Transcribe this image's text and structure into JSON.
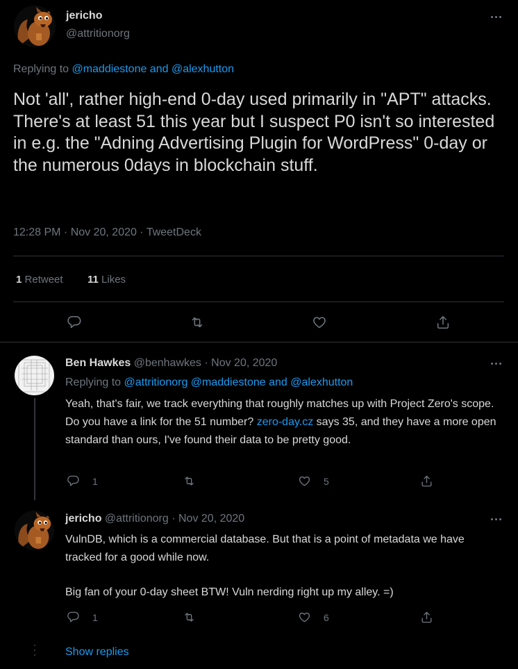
{
  "main_tweet": {
    "author_name": "jericho",
    "author_handle": "@attritionorg",
    "replying_prefix": "Replying to ",
    "replying_users": "@maddiestone and @alexhutton",
    "text": "Not 'all', rather high-end 0-day used primarily in \"APT\" attacks. There's at least 51 this year but I suspect P0 isn't so interested in e.g. the \"Adning Advertising Plugin for WordPress\" 0-day or the numerous 0days in blockchain stuff.",
    "meta": "12:28 PM · Nov 20, 2020 · TweetDeck",
    "retweet_count": "1",
    "retweet_label": "Retweet",
    "like_count": "11",
    "like_label": "Likes"
  },
  "replies": [
    {
      "author_name": "Ben Hawkes",
      "author_handle": "@benhawkes",
      "separator": "·",
      "date": "Nov 20, 2020",
      "replying_prefix": "Replying to ",
      "replying_users": "@attritionorg @maddiestone and @alexhutton",
      "text_before_link": "Yeah, that's fair, we track everything that roughly matches up with Project Zero's scope. Do you have a link for the 51 number? ",
      "link": "zero-day.cz",
      "text_after_link": " says 35, and they have a more open standard than ours, I've found their data to be pretty good.",
      "reply_count": "1",
      "like_count": "5"
    },
    {
      "author_name": "jericho",
      "author_handle": "@attritionorg",
      "separator": "·",
      "date": "Nov 20, 2020",
      "text_p1": "VulnDB, which is a commercial database. But that is a point of metadata we have tracked for a good while now.",
      "text_p2": "Big fan of your 0-day sheet BTW! Vuln nerding right up my alley. =)",
      "reply_count": "1",
      "like_count": "6",
      "show_replies": "Show replies"
    }
  ],
  "icons": [
    "more-icon",
    "reply-icon",
    "retweet-icon",
    "like-icon",
    "share-icon"
  ],
  "colors": {
    "background": "#000000",
    "text": "#d9d9d9",
    "muted": "#6e767d",
    "link": "#1d9bf0",
    "divider": "#2f3336"
  }
}
